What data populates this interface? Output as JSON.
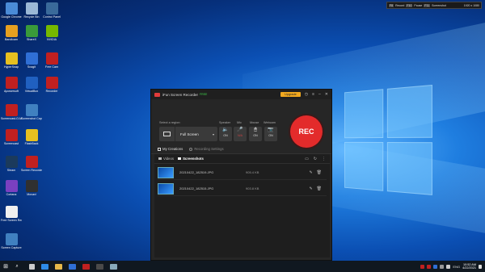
{
  "desktop_icons": [
    {
      "label": "Google Chrome",
      "color": "#4a8bd6"
    },
    {
      "label": "Recycle Bin",
      "color": "#9bb8d6"
    },
    {
      "label": "Control Panel",
      "color": "#3a6a9a"
    },
    {
      "label": "Bandicam",
      "color": "#e6a020"
    },
    {
      "label": "ShareX",
      "color": "#3a9a3a"
    },
    {
      "label": "NVIDIA",
      "color": "#76b900"
    },
    {
      "label": "HyperSnap",
      "color": "#e6c020"
    },
    {
      "label": "Snagit",
      "color": "#2f6fd6"
    },
    {
      "label": "Free Cam",
      "color": "#c02020"
    },
    {
      "label": "Apowersoft",
      "color": "#c02020"
    },
    {
      "label": "VirtualBox",
      "color": "#2060c0"
    },
    {
      "label": "Recorder",
      "color": "#c02020"
    },
    {
      "label": "Screencast-O-Matic",
      "color": "#c02020"
    },
    {
      "label": "Screenshot Capture",
      "color": "#4080c0"
    },
    {
      "label": "Screencast",
      "color": "#c02020"
    },
    {
      "label": "FlashBack",
      "color": "#e6c020"
    },
    {
      "label": "Steam",
      "color": "#1b3a5c"
    },
    {
      "label": "Screen Recorder",
      "color": "#c02020"
    },
    {
      "label": "Cortana",
      "color": "#7a40c0"
    },
    {
      "label": "Movavi",
      "color": "#303030"
    },
    {
      "label": "Free Screen Recorder",
      "color": "#f0f0f0"
    },
    {
      "label": "Screen Capture",
      "color": "#4080c0"
    }
  ],
  "overlay": {
    "items": [
      {
        "key": "F8",
        "text": "Record"
      },
      {
        "key": "F10",
        "text": "Pause"
      },
      {
        "key": "F11",
        "text": "Screenshot"
      }
    ],
    "resolution": "1920 x 1080"
  },
  "app": {
    "title": "iFun Screen Recorder",
    "free_badge": "FREE",
    "upgrade_label": "Upgrade",
    "select_region_label": "Select a region:",
    "region_value": "Full Screen",
    "toggles": [
      {
        "label": "Speaker",
        "state": "ON",
        "icon": "speaker-icon",
        "glyph": "🔈"
      },
      {
        "label": "Mic",
        "state": "N/A",
        "icon": "mic-icon",
        "glyph": "🎤"
      },
      {
        "label": "Mouse",
        "state": "ON",
        "icon": "mouse-icon",
        "glyph": "🖱"
      },
      {
        "label": "Webcam",
        "state": "ON",
        "icon": "webcam-icon",
        "glyph": "📷"
      }
    ],
    "rec_label": "REC",
    "tabs": {
      "creations": "My Creations",
      "settings": "Recording Settings"
    },
    "subtabs": {
      "videos": "Videos",
      "screenshots": "Screenshots"
    },
    "files": [
      {
        "name": "20210422_182519.JPG",
        "size": "905.4 KB"
      },
      {
        "name": "20210422_182515.JPG",
        "size": "903.8 KB"
      }
    ]
  },
  "taskbar": {
    "language": "ENG",
    "time": "10:52 AM",
    "date": "4/22/2021"
  }
}
